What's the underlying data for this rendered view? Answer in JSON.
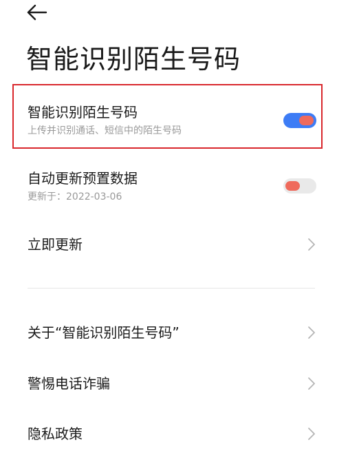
{
  "header": {
    "title": "智能识别陌生号码"
  },
  "settings": {
    "smart_identify": {
      "title": "智能识别陌生号码",
      "subtitle": "上传并识别通话、短信中的陌生号码",
      "enabled": true
    },
    "auto_update": {
      "title": "自动更新预置数据",
      "subtitle": "更新于：2022-03-06",
      "enabled": false
    },
    "update_now": {
      "title": "立即更新"
    }
  },
  "links": {
    "about": "关于“智能识别陌生号码”",
    "fraud_alert": "警惕电话诈骗",
    "privacy": "隐私政策"
  },
  "colors": {
    "toggle_on": "#3d7cf5",
    "toggle_off": "#e9e9e9",
    "knob": "#ef6a5c",
    "highlight": "#d9262b"
  },
  "icons": {
    "back": "arrow-left-icon",
    "chevron": "chevron-right-icon"
  }
}
